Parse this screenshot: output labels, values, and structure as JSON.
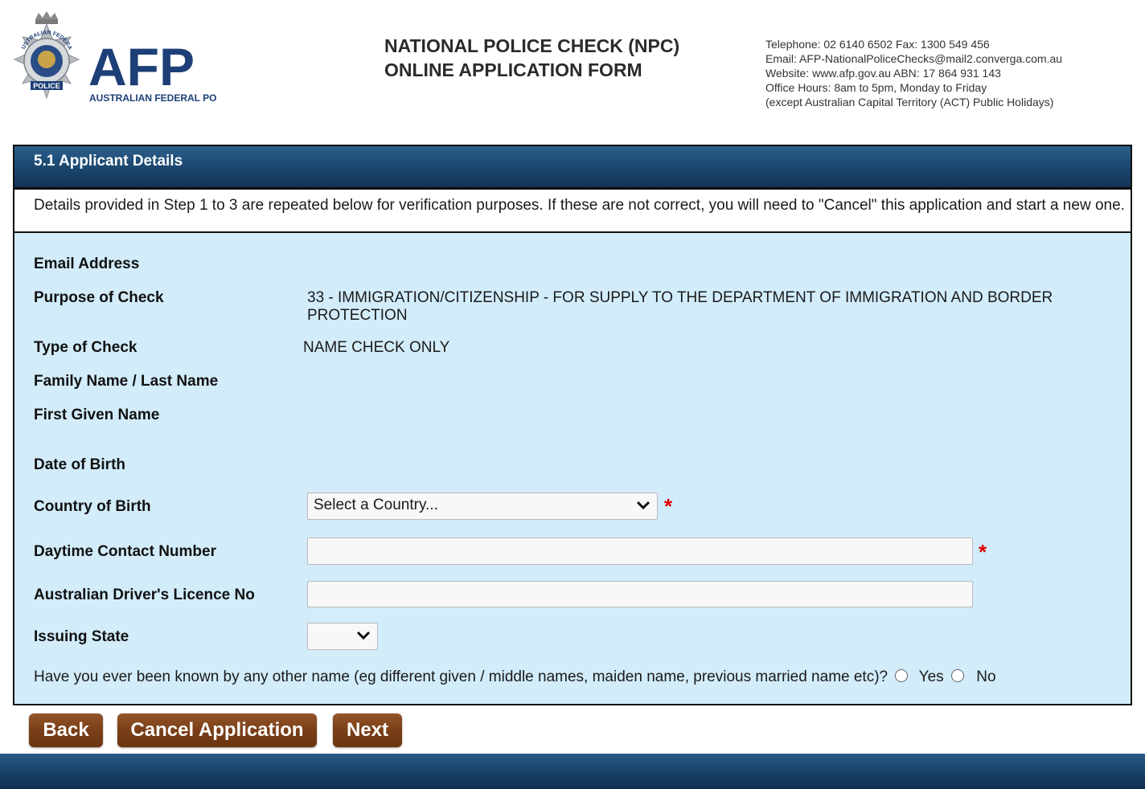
{
  "header": {
    "logo_initials": "AFP",
    "logo_subtitle": "AUSTRALIAN FEDERAL POLICE",
    "badge_arc_text": "AUSTRALIAN FEDERAL",
    "badge_text": "POLICE",
    "title_line1": "NATIONAL POLICE CHECK (NPC)",
    "title_line2": "ONLINE APPLICATION FORM",
    "contact": [
      "Telephone: 02 6140 6502  Fax: 1300 549 456",
      "Email: AFP-NationalPoliceChecks@mail2.converga.com.au",
      "Website: www.afp.gov.au    ABN: 17 864 931 143",
      "Office Hours: 8am to 5pm, Monday to Friday",
      "(except Australian Capital Territory (ACT) Public Holidays)"
    ]
  },
  "section": {
    "title": "5.1 Applicant Details",
    "note": "Details provided in Step 1 to 3 are repeated below for verification purposes. If these are not correct, you will need to \"Cancel\" this application and start a new one."
  },
  "fields": {
    "email_label": "Email Address",
    "purpose_label": "Purpose of Check",
    "purpose_value_line1": "33 - IMMIGRATION/CITIZENSHIP - FOR SUPPLY TO THE DEPARTMENT OF IMMIGRATION AND BORDER",
    "purpose_value_line2": "PROTECTION",
    "type_label": "Type of Check",
    "type_value": "NAME CHECK ONLY",
    "family_name_label": "Family Name / Last Name",
    "first_name_label": "First Given Name",
    "dob_label": "Date of Birth",
    "country_label": "Country of Birth",
    "country_selected": "Select a Country...",
    "phone_label": "Daytime Contact Number",
    "licence_label": "Australian Driver's Licence No",
    "state_label": "Issuing State",
    "state_selected": "",
    "required_mark": "*",
    "other_name_question": "Have you ever been known by any other name (eg different given / middle names, maiden name, previous married name etc)?",
    "yes_label": "Yes",
    "no_label": "No"
  },
  "buttons": {
    "back": "Back",
    "cancel": "Cancel Application",
    "next": "Next"
  },
  "colors": {
    "panel_bg": "#d2ecfa",
    "header_bar": "#1d4a73",
    "button": "#7a3f17",
    "required": "#e00000"
  }
}
